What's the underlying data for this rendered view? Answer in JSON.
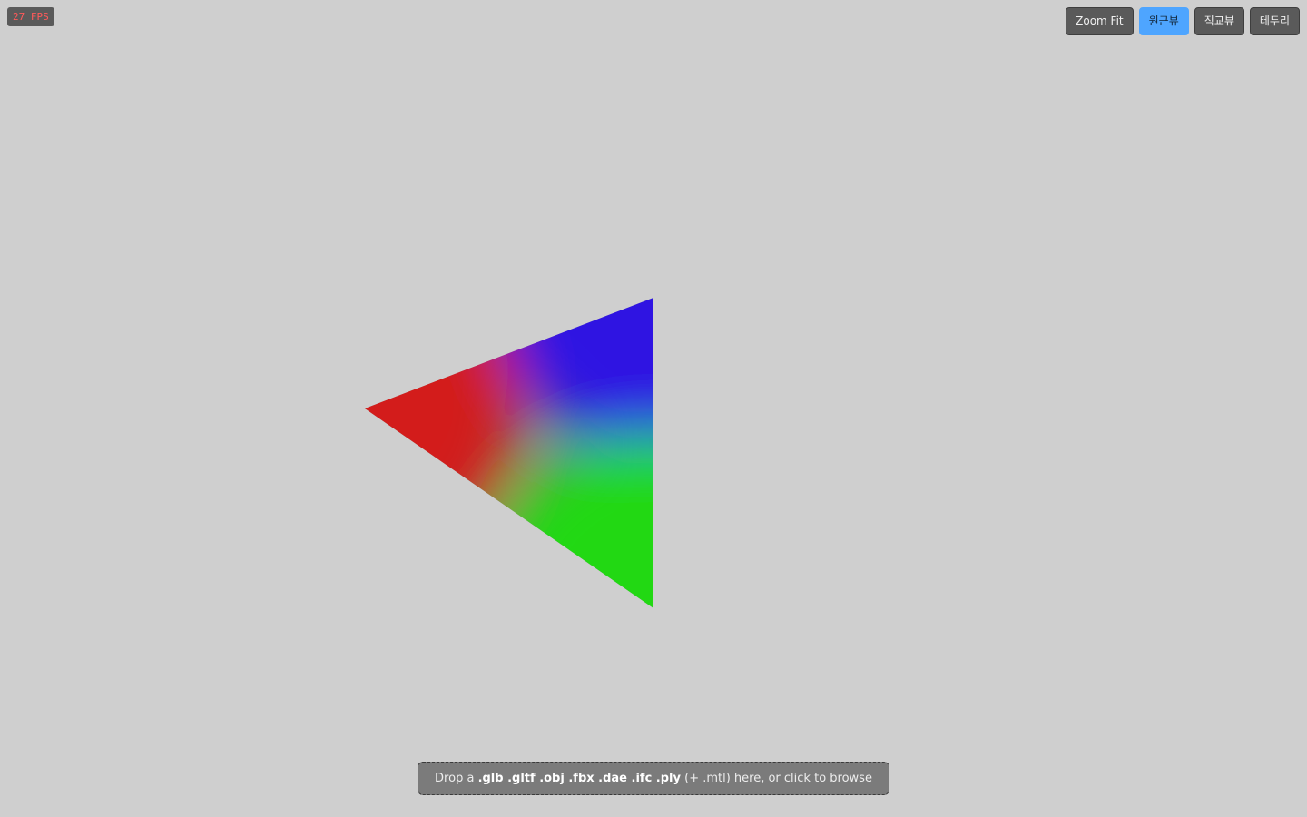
{
  "hud": {
    "fps_text": "27 FPS"
  },
  "toolbar": {
    "zoom_fit_label": "Zoom Fit",
    "perspective_label": "원근뷰",
    "orthographic_label": "직교뷰",
    "edges_label": "테두리"
  },
  "dropzone": {
    "prefix": "Drop a ",
    "formats": ".glb .gltf .obj .fbx .dae .ifc .ply",
    "suffix": " (+ .mtl) here, or click to browse"
  },
  "colors": {
    "background": "#cfcfcf",
    "active_button": "#4ea5ff",
    "vertex_red": "#d81818",
    "vertex_blue": "#2a10e8",
    "vertex_green": "#1edc10"
  }
}
